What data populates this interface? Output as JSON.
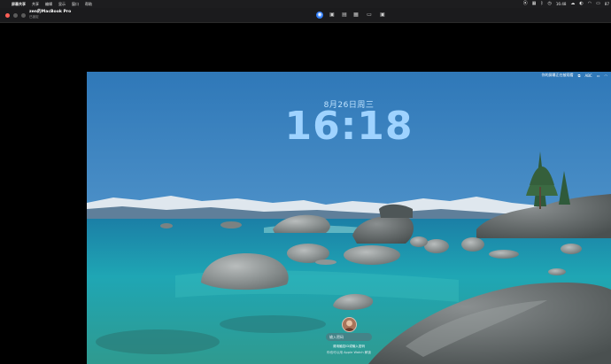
{
  "menubar": {
    "app_name": "屏幕共享",
    "menus": [
      "共享",
      "编辑",
      "显示",
      "窗口",
      "帮助"
    ],
    "right_time": "16:48",
    "battery_pct": "87"
  },
  "window": {
    "title": "zen的MacBook Pro",
    "subtitle": "已锁定"
  },
  "remote": {
    "status_text": "你的屏幕正在被观看",
    "input_source": "ABC",
    "date": "8月26日周三",
    "time": "16:18",
    "password_placeholder": "输入密码",
    "hint_line1": "请用触控ID或输入密码",
    "hint_line2": "你也可以用 Apple Watch 解锁"
  },
  "colors": {
    "close": "#ff5f57",
    "accent": "#2f7cf6"
  }
}
